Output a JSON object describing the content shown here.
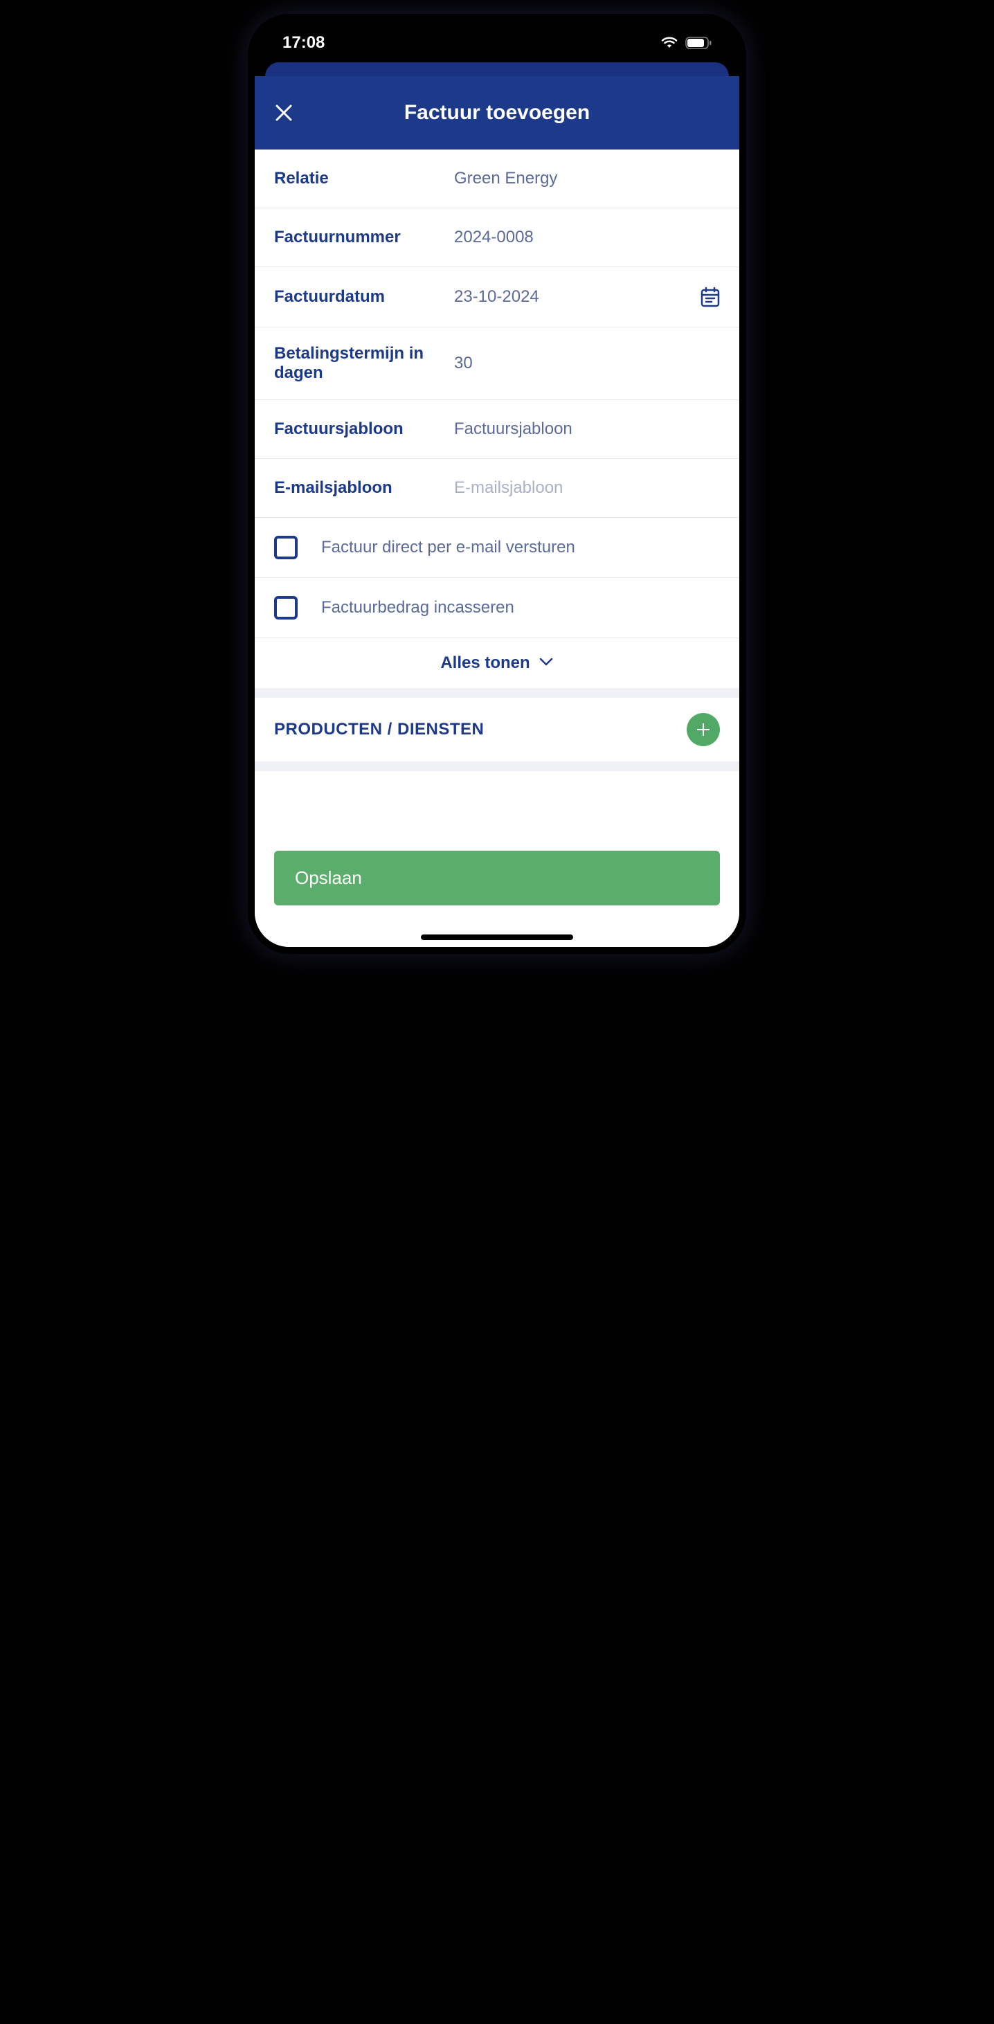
{
  "statusBar": {
    "time": "17:08"
  },
  "header": {
    "title": "Factuur toevoegen"
  },
  "fields": {
    "relation": {
      "label": "Relatie",
      "value": "Green Energy"
    },
    "invoiceNumber": {
      "label": "Factuurnummer",
      "value": "2024-0008"
    },
    "invoiceDate": {
      "label": "Factuurdatum",
      "value": "23-10-2024"
    },
    "paymentTerm": {
      "label": "Betalingstermijn in dagen",
      "value": "30"
    },
    "invoiceTemplate": {
      "label": "Factuursjabloon",
      "value": "Factuursjabloon"
    },
    "emailTemplate": {
      "label": "E-mailsjabloon",
      "placeholder": "E-mailsjabloon"
    }
  },
  "checkboxes": {
    "sendDirectEmail": {
      "label": "Factuur direct per e-mail versturen",
      "checked": false
    },
    "collectAmount": {
      "label": "Factuurbedrag incasseren",
      "checked": false
    }
  },
  "showAll": {
    "label": "Alles tonen"
  },
  "productsSection": {
    "title": "PRODUCTEN / DIENSTEN"
  },
  "footer": {
    "saveLabel": "Opslaan"
  }
}
